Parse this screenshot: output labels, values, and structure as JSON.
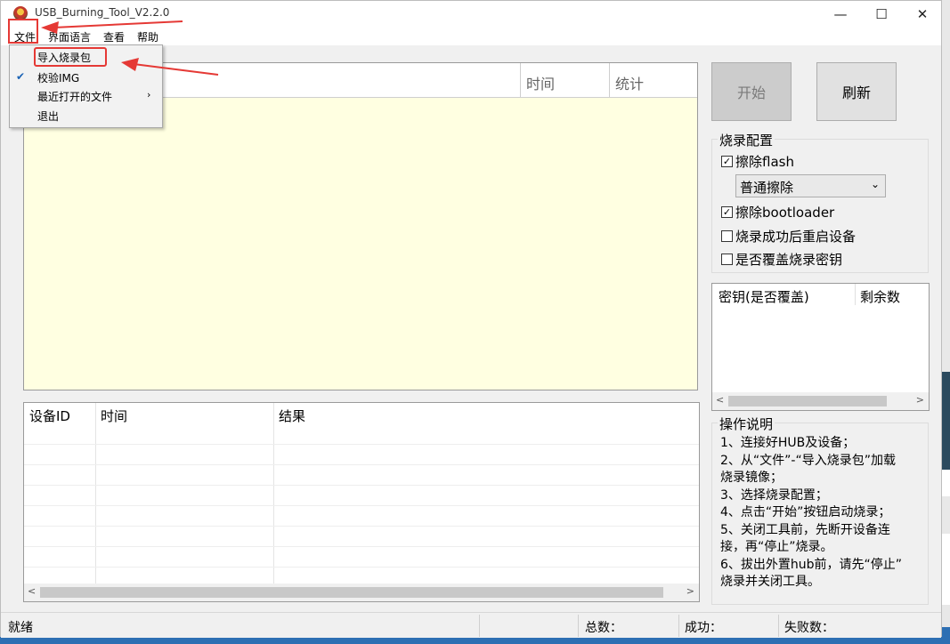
{
  "window": {
    "title": "USB_Burning_Tool_V2.2.0",
    "controls": {
      "minimize": "—",
      "maximize": "☐",
      "close": "✕"
    }
  },
  "menubar": {
    "file": "文件",
    "language": "界面语言",
    "view": "查看",
    "help": "帮助"
  },
  "file_menu": {
    "items": [
      {
        "label": "导入烧录包",
        "checked": false
      },
      {
        "label": "校验IMG",
        "checked": true
      },
      {
        "label": "最近打开的文件",
        "submenu": true
      },
      {
        "label": "退出"
      }
    ],
    "check_glyph": "✔",
    "submenu_glyph": "›"
  },
  "log_table": {
    "columns": [
      "",
      "时间",
      "统计"
    ]
  },
  "device_table": {
    "columns": [
      "设备ID",
      "时间",
      "结果"
    ]
  },
  "buttons": {
    "start": "开始",
    "refresh": "刷新"
  },
  "burn_config": {
    "title": "烧录配置",
    "erase_flash": {
      "label": "擦除flash",
      "checked": true
    },
    "erase_mode": "普通擦除",
    "erase_bootloader": {
      "label": "擦除bootloader",
      "checked": true
    },
    "reboot_after": {
      "label": "烧录成功后重启设备",
      "checked": false
    },
    "overwrite_key": {
      "label": "是否覆盖烧录密钥",
      "checked": false
    }
  },
  "key_table": {
    "columns": [
      "密钥(是否覆盖)",
      "剩余数"
    ]
  },
  "instructions": {
    "title": "操作说明",
    "lines": [
      "1、连接好HUB及设备；",
      "2、从“文件”-“导入烧录包”加载",
      "烧录镜像；",
      "3、选择烧录配置；",
      "4、点击“开始”按钮启动烧录；",
      "5、关闭工具前，先断开设备连",
      "接，再“停止”烧录。",
      "6、拔出外置hub前，请先“停止”",
      "烧录并关闭工具。"
    ]
  },
  "statusbar": {
    "status": "就绪",
    "total": "总数：",
    "success": "成功：",
    "failed": "失败数："
  },
  "colors": {
    "annotation": "#e53935",
    "log_bg": "#ffffe1",
    "check": "#1a63b5"
  }
}
